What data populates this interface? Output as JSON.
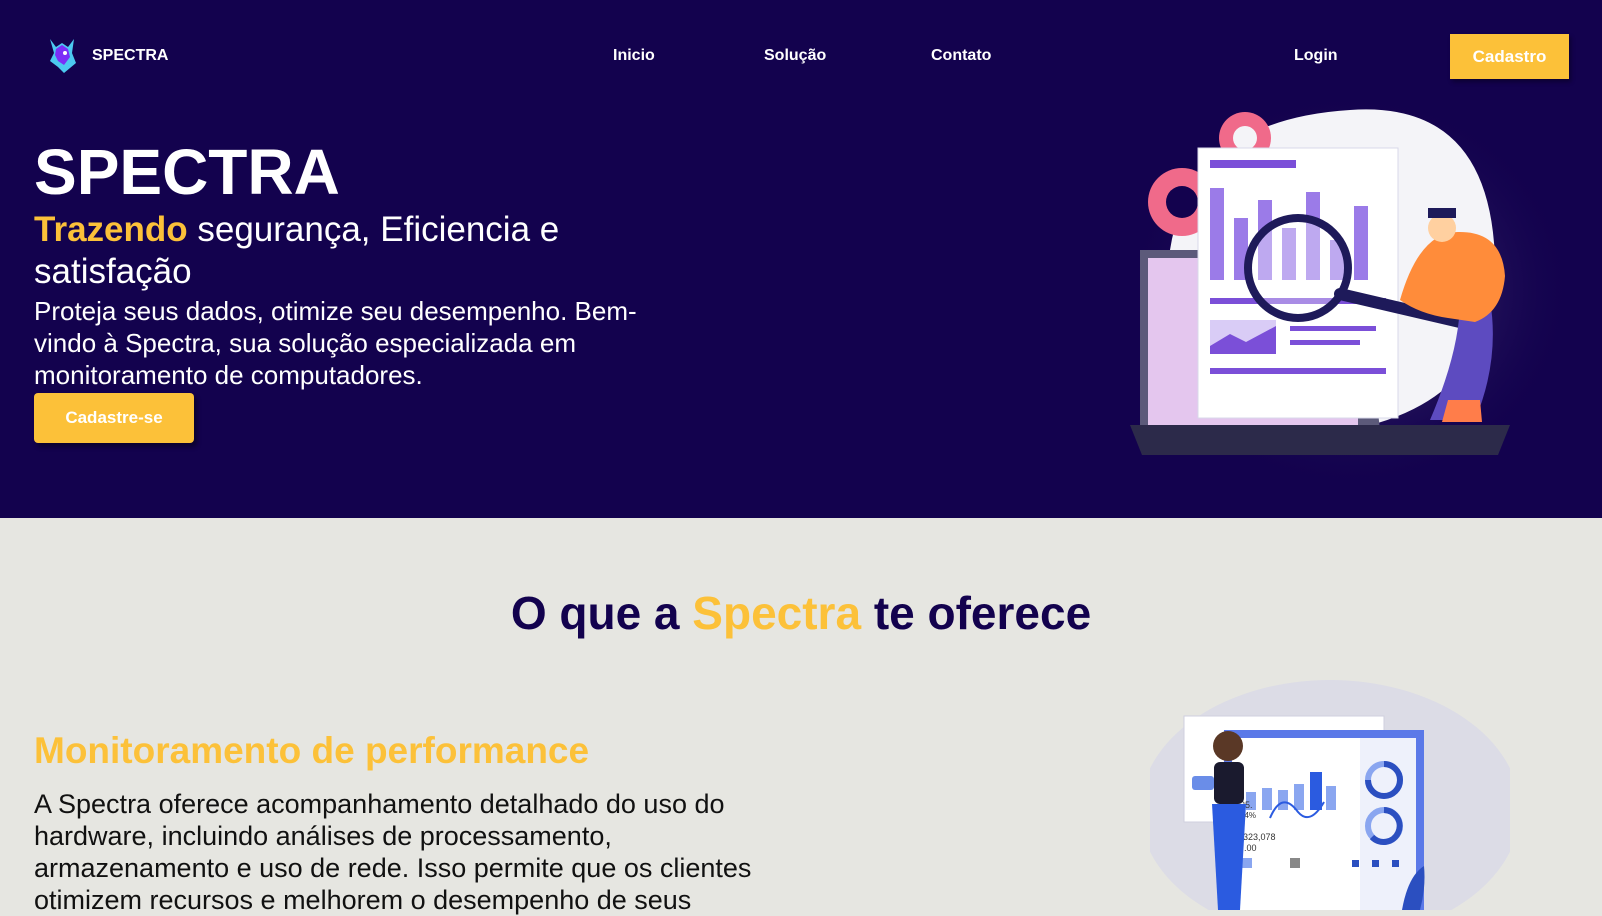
{
  "header": {
    "brand": "SPECTRA",
    "nav": [
      "Inicio",
      "Solução",
      "Contato"
    ],
    "login_label": "Login",
    "signup_label": "Cadastro"
  },
  "hero": {
    "title": "SPECTRA",
    "tagline_highlight": "Trazendo",
    "tagline_rest": " segurança, Eficiencia e satisfação",
    "description": "Proteja seus dados, otimize seu desempenho. Bem-vindo à Spectra, sua solução especializada em monitoramento de computadores.",
    "cta_label": "Cadastre-se"
  },
  "offer": {
    "title_pre": "O que a ",
    "title_highlight": "Spectra",
    "title_post": " te oferece"
  },
  "feature": {
    "title": "Monitoramento de performance",
    "description": "A Spectra oferece acompanhamento detalhado do uso do hardware, incluindo análises de processamento, armazenamento e uso de rede. Isso permite que os clientes otimizem recursos e melhorem o desempenho de seus",
    "chart_text_1": "25.",
    "chart_text_2": "64%",
    "chart_text_3": "$323,078",
    "chart_text_4": ".00"
  },
  "colors": {
    "navy": "#13024e",
    "accent": "#fcc139",
    "light_bg": "#e6e6e1"
  }
}
